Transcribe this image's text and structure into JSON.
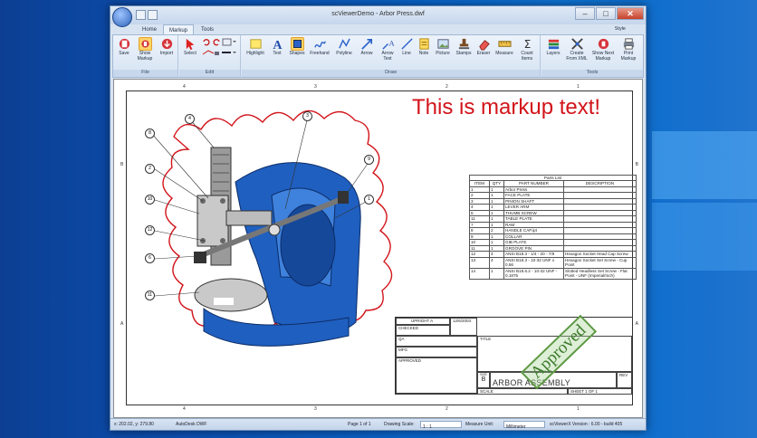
{
  "window": {
    "title": "scViewerDemo - Arbor Press.dwf",
    "controls": {
      "minimize": "–",
      "maximize": "□",
      "close": "✕"
    }
  },
  "tabs": [
    {
      "label": "Home",
      "active": false
    },
    {
      "label": "Markup",
      "active": true
    },
    {
      "label": "Tools",
      "active": false
    }
  ],
  "style_menu": "Style",
  "ribbon": {
    "groups": {
      "file": "File",
      "edit": "Edit",
      "draw": "Draw",
      "tools": "Tools"
    },
    "file": {
      "save": "Save",
      "show_markup": "Show Markup",
      "import": "Import"
    },
    "edit": {
      "select": "Select"
    },
    "draw": {
      "highlight": "Highlight",
      "text": "Text",
      "shapes": "Shapes",
      "freehand": "Freehand",
      "polyline": "Polyline",
      "arrow": "Arrow",
      "arrow_text": "Arrow Text",
      "line": "Line",
      "note": "Note",
      "picture": "Picture",
      "stamps": "Stamps",
      "eraser": "Eraser",
      "measure": "Measure",
      "count_items": "Count Items"
    },
    "tools": {
      "layers": "Layers",
      "create_from_xml": "Create From XML",
      "show_next_markup": "Show Next Markup",
      "print_markup": "Print Markup"
    }
  },
  "drawing": {
    "markup_text": "This is markup text!",
    "ruler_top": [
      "4",
      "3",
      "2",
      "1"
    ],
    "ruler_bottom": [
      "4",
      "3",
      "2",
      "1"
    ],
    "ruler_left": [
      "B",
      "A"
    ],
    "ruler_right": [
      "B",
      "A"
    ],
    "balloons": [
      "4",
      "3",
      "8",
      "2",
      "10",
      "12",
      "6",
      "9",
      "1",
      "11"
    ],
    "parts_list": {
      "caption": "Parts List",
      "headers": [
        "ITEM",
        "QTY",
        "PART NUMBER",
        "DESCRIPTION"
      ],
      "rows": [
        [
          "1",
          "1",
          "Arbor Press",
          ""
        ],
        [
          "2",
          "1",
          "FACE PLATE",
          ""
        ],
        [
          "3",
          "1",
          "PINION SHAFT",
          ""
        ],
        [
          "4",
          "1",
          "LEVER ARM",
          ""
        ],
        [
          "5",
          "1",
          "THUMB SCREW",
          ""
        ],
        [
          "11",
          "1",
          "TABLE PLATE",
          ""
        ],
        [
          "7",
          "1",
          "RAM",
          ""
        ],
        [
          "8",
          "2",
          "HANDLE CAP.ipt",
          ""
        ],
        [
          "9",
          "1",
          "COLLAR",
          ""
        ],
        [
          "10",
          "1",
          "GIB PLATE",
          ""
        ],
        [
          "11",
          "1",
          "GROOVE PIN",
          ""
        ],
        [
          "12",
          "4",
          "ANSI B18.3 - 1/4 - 20 - 7/8",
          "Hexagon Socket Head Cap Screw"
        ],
        [
          "13",
          "4",
          "ANSI B18.3 - 10-32 UNF x 0.56",
          "Hexagon Socket Set Screw - Cup Point"
        ],
        [
          "14",
          "1",
          "ANSI B18.6.2 - 10-32 UNF - 0.1875",
          "Slotted Headless Set Screw - Flat Point - UNF (Imperial/Inch)"
        ]
      ]
    },
    "title_block": {
      "upright": "UPRIGHT A",
      "date": "12/6/2003",
      "checked": "CHECKED",
      "qa": "QA",
      "mfg": "MFG",
      "approved": "APPROVED",
      "title": "TITLE",
      "size_label": "SIZE",
      "size": "B",
      "scale": "SCALE",
      "rev": "REV",
      "assembly": "ARBOR ASSEMBLY",
      "sheet": "SHEET   1   OF   1"
    },
    "stamp": "Approved"
  },
  "status": {
    "coords": "x: 202.02, y: 279.80",
    "format": "AutoDesk DWF",
    "page": "Page 1 of 1",
    "scale_label": "Drawing Scale:",
    "scale_value": "1 : 1",
    "unit_label": "Measure Unit:",
    "unit_value": "Millimeter",
    "version": "scViewerX Version : 6.00 - build 405"
  },
  "colors": {
    "markup": "#d2141a",
    "part_blue": "#1f5fbf",
    "stamp_green": "#3b7c2a"
  }
}
